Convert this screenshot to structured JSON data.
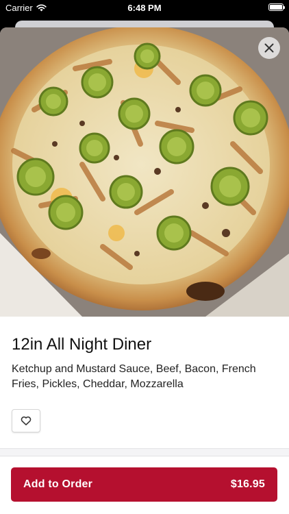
{
  "status_bar": {
    "carrier": "Carrier",
    "time": "6:48 PM"
  },
  "item": {
    "image_alt": "pizza-photo",
    "title": "12in All Night Diner",
    "description": "Ketchup and Mustard Sauce, Beef, Bacon, French Fries, Pickles, Cheddar, Mozzarella"
  },
  "order_button": {
    "label": "Add to Order",
    "price": "$16.95"
  },
  "colors": {
    "accent": "#b5102f",
    "background": "#ffffff",
    "status_bar": "#000000"
  },
  "icons": {
    "close": "close-icon",
    "favorite": "heart-icon",
    "wifi": "wifi-icon",
    "battery": "battery-icon"
  }
}
